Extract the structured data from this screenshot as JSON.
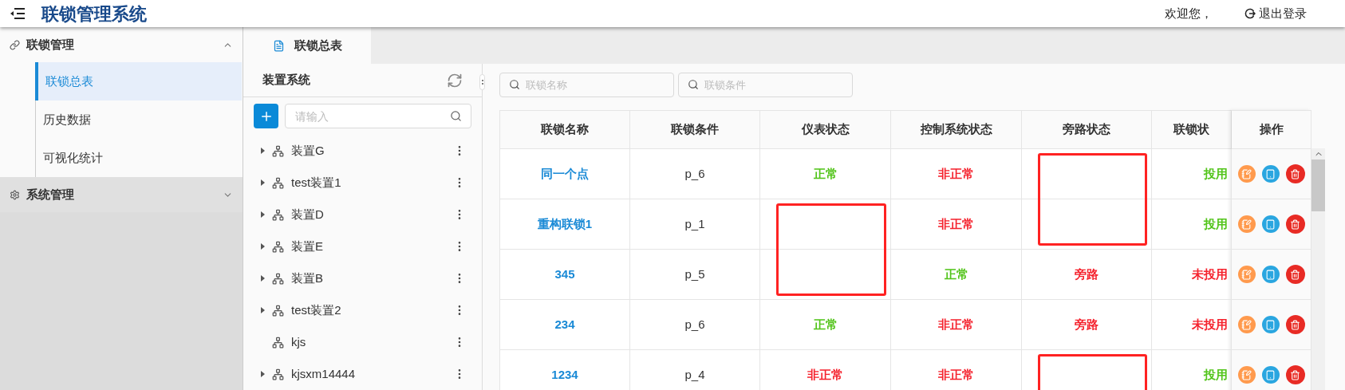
{
  "header": {
    "title": "联锁管理系统",
    "welcome": "欢迎您，",
    "logout": "退出登录"
  },
  "sidebar": {
    "groups": [
      {
        "label": "联锁管理",
        "kind": "link",
        "expanded": true,
        "items": [
          {
            "label": "联锁总表",
            "selected": true
          },
          {
            "label": "历史数据",
            "selected": false
          },
          {
            "label": "可视化统计",
            "selected": false
          }
        ]
      },
      {
        "label": "系统管理",
        "kind": "settings",
        "expanded": false
      }
    ]
  },
  "tabs": [
    {
      "label": "联锁总表",
      "selected": true
    }
  ],
  "tree": {
    "title": "装置系统",
    "search_placeholder": "请输入",
    "items": [
      {
        "label": "装置G",
        "expandable": true
      },
      {
        "label": "test装置1",
        "expandable": true
      },
      {
        "label": "装置D",
        "expandable": true
      },
      {
        "label": "装置E",
        "expandable": true
      },
      {
        "label": "装置B",
        "expandable": true
      },
      {
        "label": "test装置2",
        "expandable": true
      },
      {
        "label": "kjs",
        "expandable": false
      },
      {
        "label": "kjsxm14444",
        "expandable": true
      }
    ]
  },
  "filters": [
    {
      "placeholder": "联锁名称"
    },
    {
      "placeholder": "联锁条件"
    }
  ],
  "table": {
    "columns": [
      "联锁名称",
      "联锁条件",
      "仪表状态",
      "控制系统状态",
      "旁路状态",
      "联锁状"
    ],
    "action_column": "操作",
    "rows": [
      {
        "cells": [
          {
            "text": "同一个点",
            "kind": "link",
            "marked": false
          },
          {
            "text": "p_6",
            "kind": "plain",
            "marked": false
          },
          {
            "text": "正常",
            "kind": "good",
            "marked": false
          },
          {
            "text": "非正常",
            "kind": "bad",
            "marked": false
          },
          {
            "kind": "plain",
            "marked": true
          },
          {
            "text": "投用",
            "kind": "good",
            "marked": false
          }
        ]
      },
      {
        "cells": [
          {
            "text": "重构联锁1",
            "kind": "link",
            "marked": false
          },
          {
            "text": "p_1",
            "kind": "plain",
            "marked": false
          },
          {
            "kind": "plain",
            "marked": true
          },
          {
            "text": "非正常",
            "kind": "bad",
            "marked": false
          },
          {
            "kind": "plain",
            "marked": true
          },
          {
            "text": "投用",
            "kind": "good",
            "marked": false
          }
        ]
      },
      {
        "cells": [
          {
            "text": "345",
            "kind": "link",
            "marked": false
          },
          {
            "text": "p_5",
            "kind": "plain",
            "marked": false
          },
          {
            "kind": "plain",
            "marked": true
          },
          {
            "text": "正常",
            "kind": "good",
            "marked": false
          },
          {
            "text": "旁路",
            "kind": "bad",
            "marked": false
          },
          {
            "text": "未投用",
            "kind": "bad",
            "marked": false
          }
        ]
      },
      {
        "cells": [
          {
            "text": "234",
            "kind": "link",
            "marked": false
          },
          {
            "text": "p_6",
            "kind": "plain",
            "marked": false
          },
          {
            "text": "正常",
            "kind": "good",
            "marked": false
          },
          {
            "text": "非正常",
            "kind": "bad",
            "marked": false
          },
          {
            "text": "旁路",
            "kind": "bad",
            "marked": false
          },
          {
            "text": "未投用",
            "kind": "bad",
            "marked": false
          }
        ]
      },
      {
        "cells": [
          {
            "text": "1234",
            "kind": "link",
            "marked": false
          },
          {
            "text": "p_4",
            "kind": "plain",
            "marked": false
          },
          {
            "text": "非正常",
            "kind": "bad",
            "marked": false
          },
          {
            "text": "非正常",
            "kind": "bad",
            "marked": false
          },
          {
            "kind": "plain",
            "marked": true
          },
          {
            "text": "投用",
            "kind": "good",
            "marked": false
          }
        ]
      }
    ]
  }
}
